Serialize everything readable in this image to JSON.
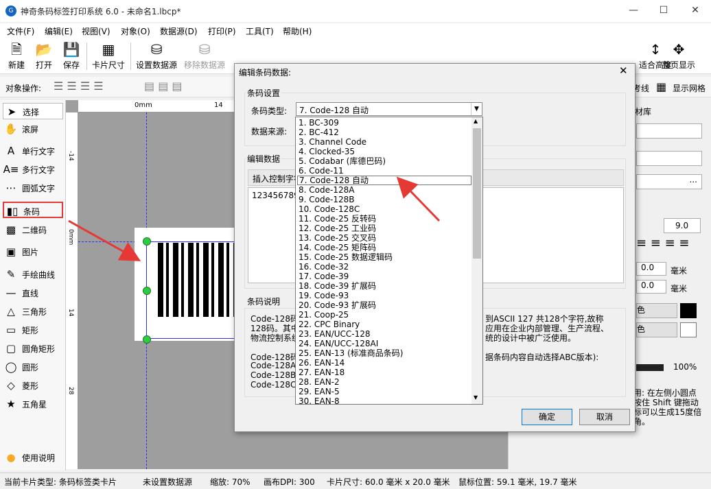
{
  "window": {
    "title": "神奇条码标签打印系统 6.0 - 未命名1.lbcp*",
    "logo": "G"
  },
  "menu": [
    "文件(F)",
    "编辑(E)",
    "视图(V)",
    "对象(O)",
    "数据源(D)",
    "打印(P)",
    "工具(T)",
    "帮助(H)"
  ],
  "toolbar": {
    "new": "新建",
    "open": "打开",
    "save": "保存",
    "card_size": "卡片尺寸",
    "set_datasource": "设置数据源",
    "remove_datasource": "移除数据源",
    "fit_height": "适合高度",
    "full_page": "整页显示"
  },
  "opsbar": {
    "label": "对象操作:",
    "show_grid": "显示网格",
    "guide_tab": "考线"
  },
  "tools": [
    "选择",
    "滚屏",
    "单行文字",
    "多行文字",
    "圆弧文字",
    "条码",
    "二维码",
    "图片",
    "手绘曲线",
    "直线",
    "三角形",
    "矩形",
    "圆角矩形",
    "圆形",
    "菱形",
    "五角星",
    "使用说明"
  ],
  "ruler": {
    "top_0": "0mm",
    "top_14": "14",
    "left_0": "0mm",
    "left_14": "14",
    "left_28": "28",
    "left_minus": "-14"
  },
  "right_panel": {
    "tab": "材库",
    "font_size": "9.0",
    "offset_x": "0.0",
    "offset_y": "0.0",
    "unit": "毫米",
    "color_label": "色",
    "opacity": "100%",
    "more": "...",
    "tip_lines": [
      "用: 在左侧小圆点",
      "按住 Shift 键拖动",
      "标可以生成15度倍",
      "角。"
    ]
  },
  "status": {
    "card_type": "当前卡片类型: 条码标签类卡片",
    "datasource": "未设置数据源",
    "zoom": "缩放: 70%",
    "dpi": "画布DPI: 300",
    "card_size": "卡片尺寸: 60.0 毫米 x 20.0 毫米",
    "mouse": "鼠标位置: 59.1 毫米, 19.7 毫米"
  },
  "dialog": {
    "title": "编辑条码数据:",
    "group_settings": "条码设置",
    "type_label": "条码类型:",
    "type_value": "7.  Code-128 自动",
    "source_label": "数据来源:",
    "group_edit": "编辑数据",
    "insert_btn": "插入控制字符",
    "data_value": "123456789",
    "group_desc": "条码说明",
    "desc_lines": [
      "Code-128码",
      "128码。其中",
      "物流控制系统",
      "",
      "Code-128码",
      "Code-128A:",
      "Code-128B:",
      "Code-128C:"
    ],
    "desc_right_lines": [
      "到ASCII 127 共128个字符,故称",
      "应用在企业内部管理、生产流程、",
      "统的设计中被广泛使用。",
      "",
      "据条码内容自动选择ABC版本):"
    ],
    "ok": "确定",
    "cancel": "取消"
  },
  "dropdown_options": [
    "1.  BC-309",
    "2.  BC-412",
    "3.  Channel Code",
    "4.  Clocked-35",
    "5.  Codabar (库德巴码)",
    "6.  Code-11",
    "7.  Code-128 自动",
    "8.  Code-128A",
    "9.  Code-128B",
    "10.  Code-128C",
    "11.  Code-25 反转码",
    "12.  Code-25 工业码",
    "13.  Code-25 交叉码",
    "14.  Code-25 矩阵码",
    "15.  Code-25 数据逻辑码",
    "16.  Code-32",
    "17.  Code-39",
    "18.  Code-39 扩展码",
    "19.  Code-93",
    "20.  Code-93 扩展码",
    "21.  Coop-25",
    "22.  CPC Binary",
    "23.  EAN/UCC-128",
    "24.  EAN/UCC-128AI",
    "25.  EAN-13 (标准商品条码)",
    "26.  EAN-14",
    "27.  EAN-18",
    "28.  EAN-2",
    "29.  EAN-5",
    "30.  EAN-8"
  ],
  "selected_index": 6,
  "colors": {
    "accent": "#0078d7",
    "highlight": "#e53935",
    "handle": "#2ecc40"
  }
}
